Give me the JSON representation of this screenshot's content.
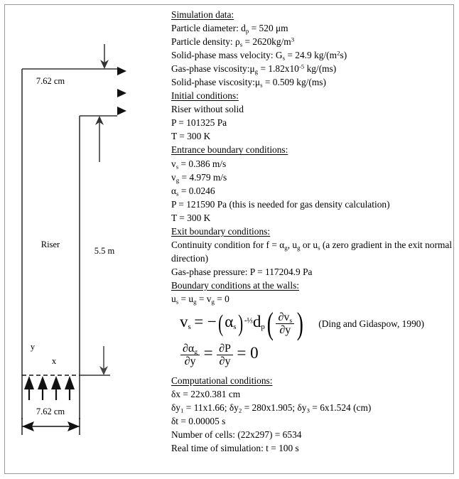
{
  "diagram": {
    "labels": {
      "width_top": "7.62 cm",
      "riser": "Riser",
      "height": "5.5 m",
      "axis_y": "y",
      "axis_x": "x",
      "width_bottom": "7.62 cm"
    }
  },
  "text": {
    "simulation_data_header": "Simulation data:",
    "particle_diameter_label": "Particle diameter:",
    "particle_diameter_sym": "d",
    "particle_diameter_sub": "p",
    "particle_diameter_val": "= 520 μm",
    "particle_density_label": "Particle density:",
    "particle_density_sym": "ρ",
    "particle_density_sub": "s",
    "particle_density_val": "= 2620kg/m",
    "particle_density_exp": "3",
    "solid_mass_velocity_label": "Solid-phase mass velocity:",
    "solid_mass_velocity_sym": "G",
    "solid_mass_velocity_sub": "s",
    "solid_mass_velocity_val": "= 24.9 kg/(m",
    "solid_mass_velocity_exp": "2",
    "solid_mass_velocity_tail": "s)",
    "gas_viscosity_label": "Gas-phase viscosity:",
    "gas_viscosity_sym": "μ",
    "gas_viscosity_sub": "g",
    "gas_viscosity_val": "= 1.82x10",
    "gas_viscosity_exp": "-5",
    "gas_viscosity_tail": "kg/(ms)",
    "solid_viscosity_label": "Solid-phase viscosity:",
    "solid_viscosity_sym": "μ",
    "solid_viscosity_sub": "s",
    "solid_viscosity_val": "= 0.509 kg/(ms)",
    "initial_conditions_header": "Initial conditions:",
    "riser_without_solid": "Riser without solid",
    "initial_pressure": "P = 101325 Pa",
    "initial_temperature": "T = 300 K",
    "entrance_bc_header": "Entrance boundary conditions:",
    "vs_sym": "v",
    "vs_sub": "s",
    "vs_val": "= 0.386 m/s",
    "vg_sym": "v",
    "vg_sub": "g",
    "vg_val": "= 4.979 m/s",
    "alpha_s_sym": "α",
    "alpha_s_sub": "s",
    "alpha_s_val": "= 0.0246",
    "entrance_pressure": "P = 121590 Pa (this is needed for gas density calculation)",
    "entrance_temperature": "T = 300 K",
    "exit_bc_header": "Exit boundary conditions:",
    "continuity_pre": "Continuity condition for f =",
    "continuity_a1": "α",
    "continuity_a1_sub": "g",
    "continuity_mid": ", u",
    "continuity_a2_sub": "g",
    "continuity_or": " or u",
    "continuity_a3_sub": "s",
    "continuity_post": " (a zero gradient in the exit normal direction)",
    "gas_pressure": "Gas-phase pressure: P = 117204.9 Pa",
    "wall_bc_header": "Boundary conditions at the walls:",
    "wall_zero_u": "u",
    "wall_zero_u_sub": "s",
    "wall_zero_eq1": "= u",
    "wall_zero_g_sub": "g",
    "wall_zero_eq2": "= v",
    "wall_zero_vg_sub": "g",
    "wall_zero_eq3": "= 0",
    "computational_header": "Computational conditions:",
    "dx": "δx = 22x0.381 cm",
    "dy_sym1": "δy",
    "dy_sub1": "1",
    "dy_val1": "= 11x1.66;",
    "dy_sym2": "δy",
    "dy_sub2": "2",
    "dy_val2": "= 280x1.905;",
    "dy_sym3": "δy",
    "dy_sub3": "3",
    "dy_val3": "= 6x1.524 (cm)",
    "dt": "δt = 0.00005 s",
    "number_of_cells": "Number of cells: (22x297) = 6534",
    "real_time": "Real time of simulation: t = 100 s"
  },
  "equations": {
    "eq1": {
      "lhs_sym": "v",
      "lhs_sub": "s",
      "eq_minus": "= −",
      "paren_open": "(",
      "alpha": "α",
      "alpha_sub": "s",
      "paren_close": ")",
      "exponent": "-⅓",
      "dp_sym": "d",
      "dp_sub": "p",
      "num": "∂v",
      "num_sub": "s",
      "den": "∂y",
      "citation": "(Ding and Gidaspow, 1990)"
    },
    "eq2": {
      "num1": "∂α",
      "num1_sub": "g",
      "den1": "∂y",
      "equals1": "=",
      "num2": "∂P",
      "den2": "∂y",
      "equals2": "= 0"
    }
  }
}
